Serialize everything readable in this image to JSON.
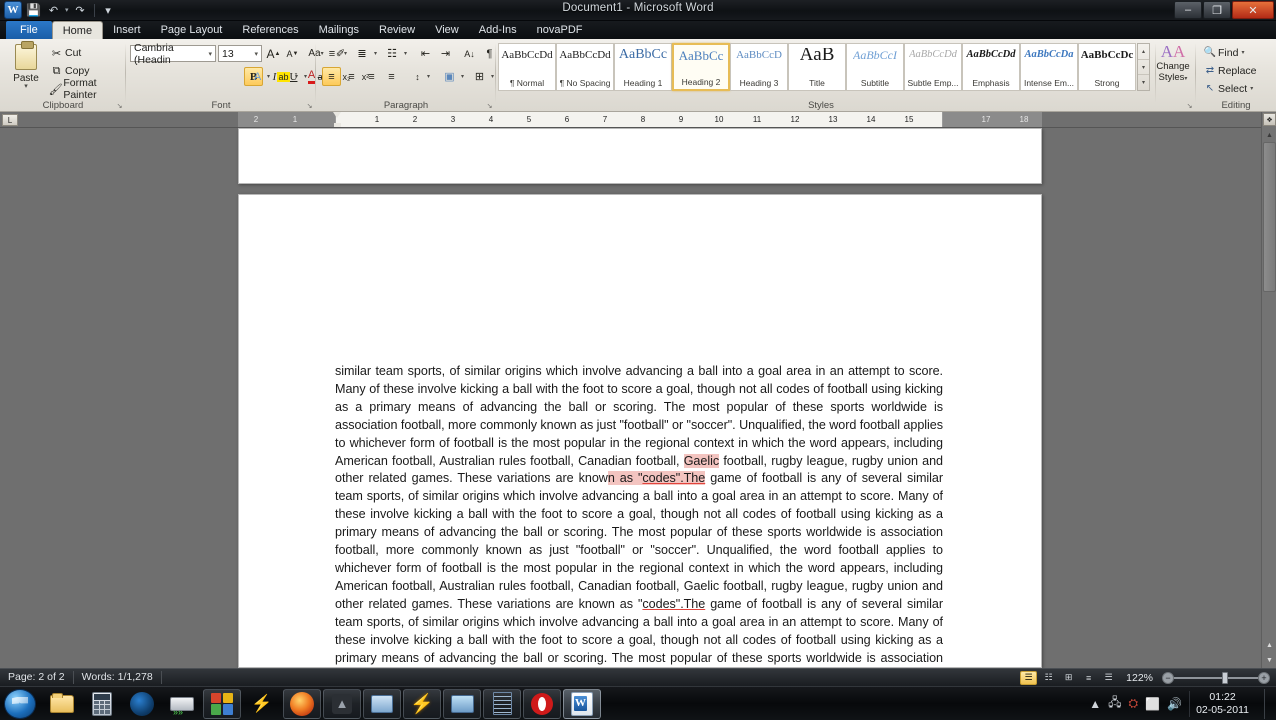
{
  "window": {
    "title": "Document1 - Microsoft Word",
    "minimize_label": "–",
    "restore_label": "❐",
    "close_label": "✕"
  },
  "quick_access": {
    "app_logo": "W",
    "save_label": "💾",
    "undo_label": "↶",
    "redo_label": "↷",
    "customize_label": "▾"
  },
  "tabs": [
    {
      "label": "File",
      "kind": "file"
    },
    {
      "label": "Home",
      "kind": "active"
    },
    {
      "label": "Insert",
      "kind": "normal"
    },
    {
      "label": "Page Layout",
      "kind": "normal"
    },
    {
      "label": "References",
      "kind": "normal"
    },
    {
      "label": "Mailings",
      "kind": "normal"
    },
    {
      "label": "Review",
      "kind": "normal"
    },
    {
      "label": "View",
      "kind": "normal"
    },
    {
      "label": "Add-Ins",
      "kind": "normal"
    },
    {
      "label": "novaPDF",
      "kind": "normal"
    }
  ],
  "ribbon": {
    "clipboard": {
      "group_label": "Clipboard",
      "paste_label": "Paste",
      "paste_caret": "▾",
      "cut_label": "Cut",
      "copy_label": "Copy",
      "format_painter_label": "Format Painter",
      "cut_icon": "✂",
      "copy_icon": "⧉",
      "painter_icon": "🖌",
      "launcher": "↘"
    },
    "font": {
      "group_label": "Font",
      "font_name": "Cambria (Headin",
      "font_size": "13",
      "grow_font": "A",
      "shrink_font": "A",
      "change_case": "Aa",
      "clear_formatting": "✐",
      "bold": "B",
      "italic": "I",
      "underline": "U",
      "strikethrough": "abc",
      "subscript": "x₂",
      "superscript": "x²",
      "text_effects": "A",
      "highlight": "ab",
      "font_color": "A",
      "launcher": "↘"
    },
    "paragraph": {
      "group_label": "Paragraph",
      "bullets": "≡",
      "numbering": "≣",
      "multilevel": "☷",
      "decrease_indent": "⇤",
      "increase_indent": "⇥",
      "sort": "A↓",
      "show_marks": "¶",
      "align_left": "≡",
      "align_center": "≡",
      "align_right": "≡",
      "justify": "≡",
      "line_spacing": "↕",
      "shading": "▣",
      "borders": "⊞",
      "launcher": "↘"
    },
    "styles": {
      "group_label": "Styles",
      "items": [
        {
          "sample": "AaBbCcDd",
          "name": "¶ Normal",
          "selected": false
        },
        {
          "sample": "AaBbCcDd",
          "name": "¶ No Spacing",
          "selected": false
        },
        {
          "sample": "AaBbCc",
          "name": "Heading 1",
          "selected": false
        },
        {
          "sample": "AaBbCc",
          "name": "Heading 2",
          "selected": true
        },
        {
          "sample": "AaBbCcD",
          "name": "Heading 3",
          "selected": false
        },
        {
          "sample": "AaB",
          "name": "Title",
          "selected": false
        },
        {
          "sample": "AaBbCcI",
          "name": "Subtitle",
          "selected": false
        },
        {
          "sample": "AaBbCcDd",
          "name": "Subtle Emp...",
          "selected": false
        },
        {
          "sample": "AaBbCcDd",
          "name": "Emphasis",
          "selected": false
        },
        {
          "sample": "AaBbCcDa",
          "name": "Intense Em...",
          "selected": false
        },
        {
          "sample": "AaBbCcDc",
          "name": "Strong",
          "selected": false
        }
      ],
      "scroll_up": "▴",
      "scroll_down": "▾",
      "more": "▾",
      "change_styles_label": "Change",
      "change_styles_label2": "Styles",
      "change_styles_caret": "▾",
      "launcher": "↘"
    },
    "editing": {
      "group_label": "Editing",
      "find_label": "Find",
      "replace_label": "Replace",
      "select_label": "Select",
      "find_icon": "🔍",
      "replace_icon": "⇄",
      "select_icon": "↖",
      "caret": "▾"
    }
  },
  "ruler": {
    "corner_tab_label": "L",
    "left_ticks": [
      "2",
      "1"
    ],
    "right_ticks": [
      "1",
      "2",
      "3",
      "4",
      "5",
      "6",
      "7",
      "8",
      "9",
      "10",
      "11",
      "12",
      "13",
      "14",
      "15",
      "17",
      "18"
    ]
  },
  "document": {
    "paragraph_part1": "similar team sports, of similar origins which involve advancing a ball into a goal area in an attempt to score. Many of these involve kicking a ball with the foot to score a goal, though not all codes of football using kicking as a primary means of advancing the ball or scoring. The most popular of these sports worldwide is association football, more commonly known as just \"football\" or \"soccer\". Unqualified, the word football applies to whichever form of football is the most popular in the regional context in which the word appears, including American football, Australian rules football, Canadian football, ",
    "highlight1": "Gaelic",
    "paragraph_part2": " football, rugby league, rugby union and other related games. These variations are know",
    "highlight2": "n as \"",
    "highlight_spell": "codes\".The",
    "paragraph_part3": " game of football is any of several similar team sports, of similar origins which involve advancing a ball into a goal area in an attempt to score. Many of these involve kicking a ball with the foot to score a goal, though not all codes of football using kicking as a primary means of advancing the ball or scoring. The most popular of these sports worldwide is association football, more commonly known as just \"football\" or \"soccer\". Unqualified, the word football applies to whichever form of football is the most popular in the regional context in which the word appears, including American football, Australian rules football, Canadian football, Gaelic football, rugby league, rugby union and other related games. These variations are known as \"",
    "spell2": "codes\".The",
    "paragraph_part4": " game of football is any of several similar team sports, of similar origins which involve advancing a ball into a goal area in an attempt to score. Many of these involve kicking a ball with the foot to score a goal, though not all codes of football using kicking as a primary means of advancing the ball or scoring. The most popular of these sports worldwide is association football, more commonly known as just \"football\" or \"soccer\". Unqualified, the word football applies to whichever form of football is the most popular in the regional context in which the word appears, including American football,",
    "selection_color": "#f3c4c0",
    "spellcheck_color": "#e2443c"
  },
  "scrollbar": {
    "top_button": "❖",
    "up_arrow": "▲",
    "prev_page": "▲",
    "down_arrow": "▼"
  },
  "status_bar": {
    "page_label": "Page: 2 of 2",
    "words_label": "Words: 1/1,278",
    "views": [
      {
        "name": "print-layout",
        "glyph": "☰",
        "active": true
      },
      {
        "name": "full-screen-reading",
        "glyph": "☷",
        "active": false
      },
      {
        "name": "web-layout",
        "glyph": "⊞",
        "active": false
      },
      {
        "name": "outline",
        "glyph": "≡",
        "active": false
      },
      {
        "name": "draft",
        "glyph": "☰",
        "active": false
      }
    ],
    "zoom_level": "122%",
    "zoom_out": "−",
    "zoom_in": "+"
  },
  "taskbar": {
    "start_label": "Start",
    "items": [
      {
        "name": "windows-explorer-icon",
        "kind": "folder",
        "running": false
      },
      {
        "name": "calculator-icon",
        "kind": "calc",
        "running": false
      },
      {
        "name": "firefox-orb-icon",
        "kind": "ffdark",
        "running": false
      },
      {
        "name": "disk-stack-icon",
        "kind": "disks",
        "running": false
      },
      {
        "name": "office-suite-icon",
        "kind": "quad",
        "running": true
      },
      {
        "name": "lightning-icon",
        "kind": "bolt2",
        "running": false
      },
      {
        "name": "firefox-icon",
        "kind": "ff",
        "running": true
      },
      {
        "name": "dark-app-icon",
        "kind": "dark",
        "running": true
      },
      {
        "name": "media-burner-icon",
        "kind": "monitor",
        "running": true
      },
      {
        "name": "winamp-icon",
        "kind": "bolt",
        "running": true
      },
      {
        "name": "control-panel-icon",
        "kind": "panel",
        "running": true
      },
      {
        "name": "notepad-icon",
        "kind": "notepad",
        "running": true
      },
      {
        "name": "opera-icon",
        "kind": "opera",
        "running": true
      },
      {
        "name": "microsoft-word-icon",
        "kind": "word",
        "running": true,
        "active": true
      }
    ],
    "tray": {
      "show_hidden": "▲",
      "network_icon": "🖧",
      "security_icon": "⛭",
      "display_icon": "⬜",
      "volume_icon": "🔊",
      "time": "01:22",
      "date": "02-05-2011"
    }
  }
}
